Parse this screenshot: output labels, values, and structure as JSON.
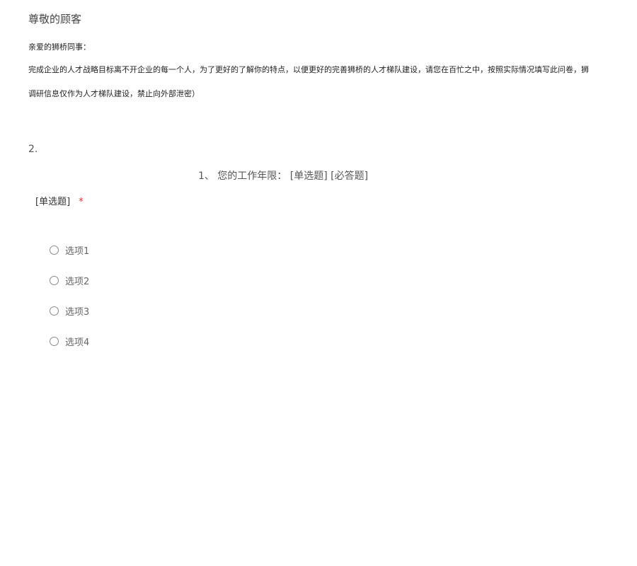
{
  "header": {
    "title": "尊敬的顾客"
  },
  "intro": {
    "greeting": "亲爱的狮桥同事：",
    "line1": "完成企业的人才战略目标离不开企业的每一个人，为了更好的了解你的特点，以便更好的完善狮桥的人才梯队建设，请您在百忙之中，按照实际情况填写此问卷，狮",
    "line2": "调研信息仅作为人才梯队建设，禁止向外部泄密）"
  },
  "question": {
    "number": "2.",
    "title": "1、 您的工作年限：  [单选题] [必答题]",
    "type_label": "[单选题]",
    "required_mark": "*",
    "options": [
      {
        "label": "选项1"
      },
      {
        "label": "选项2"
      },
      {
        "label": "选项3"
      },
      {
        "label": "选项4"
      }
    ]
  }
}
